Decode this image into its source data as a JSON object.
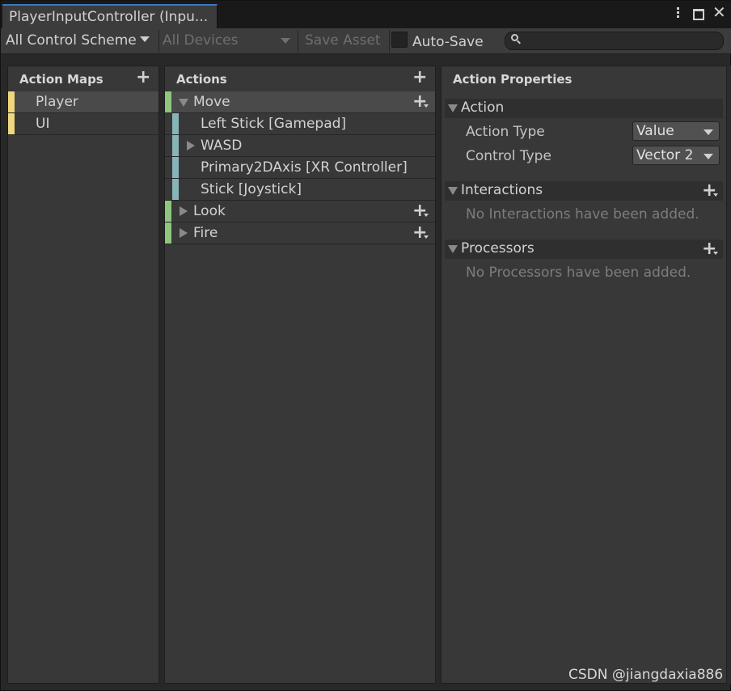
{
  "window": {
    "tab_title": "PlayerInputController (Inpu...",
    "controls": {
      "menu_icon": "kebab-menu-icon",
      "maximize_icon": "maximize-icon",
      "close_icon": "close-icon",
      "close_glyph": "✕"
    }
  },
  "toolbar": {
    "control_scheme": "All Control Scheme",
    "devices": "All Devices",
    "save_asset": "Save Asset",
    "auto_save_label": "Auto-Save",
    "auto_save_checked": false,
    "search_value": "",
    "search_icon": "search-icon"
  },
  "action_maps": {
    "title": "Action Maps",
    "add_glyph": "+",
    "items": [
      {
        "label": "Player",
        "selected": true
      },
      {
        "label": "UI",
        "selected": false
      }
    ]
  },
  "actions": {
    "title": "Actions",
    "add_glyph": "+",
    "items": [
      {
        "label": "Move",
        "kind": "action",
        "expanded": true
      },
      {
        "label": "Left Stick [Gamepad]",
        "kind": "binding"
      },
      {
        "label": "WASD",
        "kind": "composite",
        "expanded": false
      },
      {
        "label": "Primary2DAxis [XR Controller]",
        "kind": "binding"
      },
      {
        "label": "Stick [Joystick]",
        "kind": "binding"
      },
      {
        "label": "Look",
        "kind": "action",
        "expanded": false
      },
      {
        "label": "Fire",
        "kind": "action",
        "expanded": false
      }
    ]
  },
  "properties": {
    "title": "Action Properties",
    "action_section": "Action",
    "action_type_label": "Action Type",
    "action_type_value": "Value",
    "control_type_label": "Control Type",
    "control_type_value": "Vector 2",
    "interactions_section": "Interactions",
    "interactions_empty": "No Interactions have been added.",
    "processors_section": "Processors",
    "processors_empty": "No Processors have been added."
  },
  "watermark": "CSDN @jiangdaxia886",
  "colors": {
    "action_map_bar": "#f0d77e",
    "action_bar": "#8ec57f",
    "binding_bar": "#87b4b8",
    "tab_accent": "#3a79bb"
  }
}
